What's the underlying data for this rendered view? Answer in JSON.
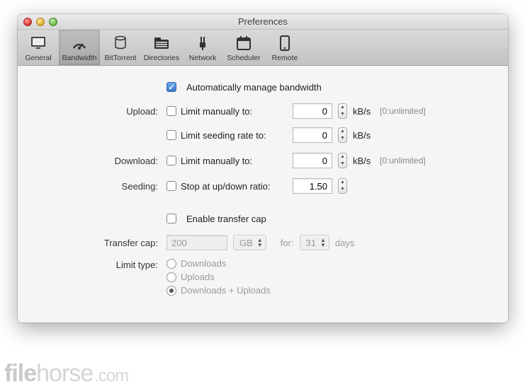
{
  "window": {
    "title": "Preferences"
  },
  "toolbar": {
    "tabs": [
      {
        "label": "General"
      },
      {
        "label": "Bandwidth"
      },
      {
        "label": "BitTorrent"
      },
      {
        "label": "Directories"
      },
      {
        "label": "Network"
      },
      {
        "label": "Scheduler"
      },
      {
        "label": "Remote"
      }
    ]
  },
  "auto": {
    "label": "Automatically manage bandwidth"
  },
  "upload": {
    "section": "Upload:",
    "limit_label": "Limit manually to:",
    "limit_value": "0",
    "unit": "kB/s",
    "hint": "[0:unlimited]",
    "seed_label": "Limit seeding rate to:",
    "seed_value": "0"
  },
  "download": {
    "section": "Download:",
    "limit_label": "Limit manually to:",
    "limit_value": "0",
    "unit": "kB/s",
    "hint": "[0:unlimited]"
  },
  "seeding": {
    "section": "Seeding:",
    "ratio_label": "Stop at up/down ratio:",
    "ratio_value": "1.50"
  },
  "cap": {
    "enable_label": "Enable transfer cap",
    "section": "Transfer cap:",
    "value": "200",
    "unit": "GB",
    "for": "for:",
    "period": "31",
    "period_unit": "days"
  },
  "limit": {
    "section": "Limit type:",
    "opt_dl": "Downloads",
    "opt_ul": "Uploads",
    "opt_both": "Downloads + Uploads"
  },
  "watermark": {
    "a": "file",
    "b": "horse",
    "c": ".com"
  }
}
